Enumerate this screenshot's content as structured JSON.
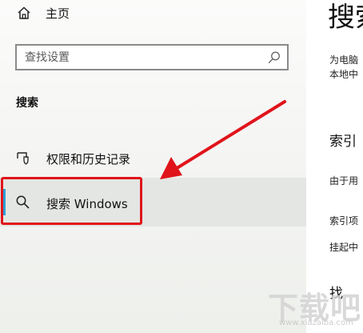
{
  "nav": {
    "home_label": "主页",
    "search_placeholder": "查找设置",
    "section_title": "搜索",
    "items": [
      {
        "label": "权限和历史记录",
        "icon": "shield-icon"
      },
      {
        "label": "搜索 Windows",
        "icon": "search-icon",
        "selected": true
      }
    ]
  },
  "content": {
    "title": "搜索",
    "lines": [
      "为电脑",
      "本地中",
      "索引",
      "由于用",
      "索引项",
      "挂起中",
      "找"
    ]
  },
  "annotation": {
    "highlight_color": "#e0141b"
  },
  "accent_color": "#2e9fd6",
  "watermark": {
    "text": "下载吧",
    "sub": "www.xiazaiba.com"
  }
}
